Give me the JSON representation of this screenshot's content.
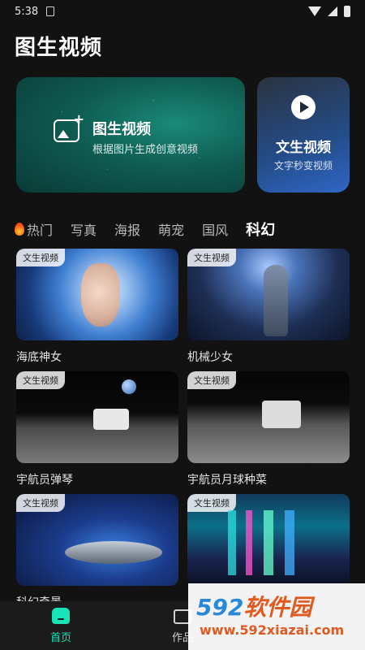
{
  "status_bar": {
    "time": "5:38"
  },
  "header": {
    "title": "图生视频"
  },
  "hero": {
    "title": "图生视频",
    "subtitle": "根据图片生成创意视频"
  },
  "text_video": {
    "title": "文生视频",
    "subtitle": "文字秒变视频"
  },
  "tabs": [
    {
      "label": "热门",
      "icon": "fire-icon"
    },
    {
      "label": "写真"
    },
    {
      "label": "海报"
    },
    {
      "label": "萌宠"
    },
    {
      "label": "国风"
    },
    {
      "label": "科幻",
      "active": true
    }
  ],
  "cards": [
    {
      "badge": "文生视频",
      "title": "海底神女"
    },
    {
      "badge": "文生视频",
      "title": "机械少女"
    },
    {
      "badge": "文生视频",
      "title": "宇航员弹琴"
    },
    {
      "badge": "文生视频",
      "title": "宇航员月球种菜"
    },
    {
      "badge": "文生视频",
      "title": "科幻奇景"
    },
    {
      "badge": "文生视频",
      "title": ""
    }
  ],
  "bottom_nav": [
    {
      "label": "首页",
      "icon": "home-icon",
      "active": true
    },
    {
      "label": "作品",
      "icon": "folder-icon"
    }
  ],
  "watermark": {
    "brand": "592",
    "brand_cn": "软件园",
    "url": "www.592xiazai.com"
  },
  "colors": {
    "accent": "#19e3b8",
    "background": "#121212"
  }
}
